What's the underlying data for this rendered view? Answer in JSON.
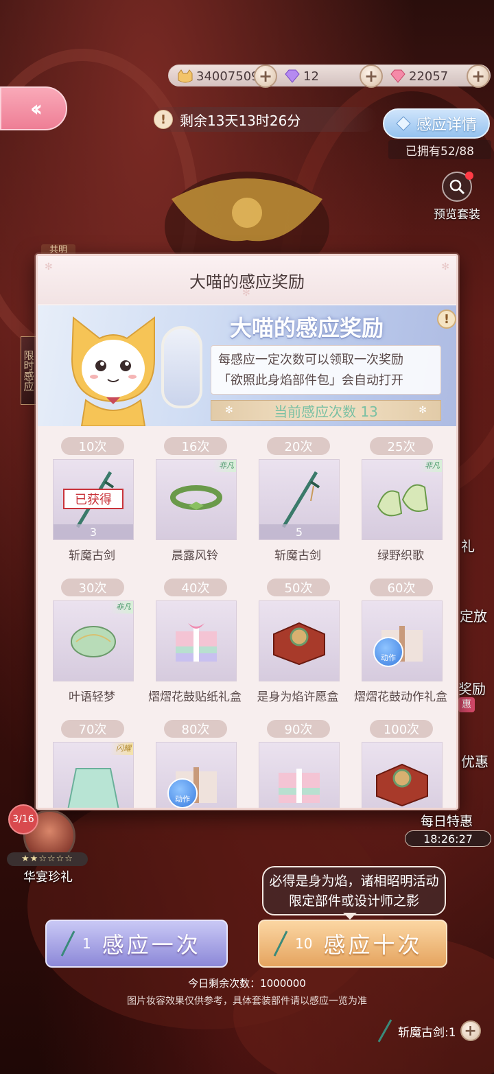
{
  "topbar": {
    "gold": "34007509",
    "diamond_purple": "12",
    "diamond_pink": "22057"
  },
  "timer": {
    "text": "剩余13天13时26分"
  },
  "detail": {
    "label": "感应详情",
    "owned": "已拥有52/88"
  },
  "preview": {
    "label": "预览套装"
  },
  "side": {
    "left_tag": "限时感应",
    "left_badge": "共明",
    "right_1": "礼",
    "right_2": "定放",
    "right_3": "奖励",
    "right_4": "惠",
    "right_5": "优惠"
  },
  "modal": {
    "title": "大喵的感应奖励",
    "banner_title": "大喵的感应奖励",
    "desc_line1": "每感应一定次数可以领取一次奖励",
    "desc_line2": "「欲照此身焰部件包」会自动打开",
    "current_count": "当前感应次数 13",
    "acquired_label": "已获得",
    "rarity_label": "非凡",
    "rarity_label_gold": "闪耀",
    "motion_label": "动作",
    "items": [
      {
        "count": "10次",
        "name": "斩魔古剑",
        "qty": "3",
        "acquired": true
      },
      {
        "count": "16次",
        "name": "晨露风铃",
        "qty": "",
        "rarity": "non"
      },
      {
        "count": "20次",
        "name": "斩魔古剑",
        "qty": "5"
      },
      {
        "count": "25次",
        "name": "绿野织歌",
        "qty": "",
        "rarity": "non"
      },
      {
        "count": "30次",
        "name": "叶语轻梦",
        "qty": "",
        "rarity": "non"
      },
      {
        "count": "40次",
        "name": "熠熠花鼓贴纸礼盒",
        "qty": ""
      },
      {
        "count": "50次",
        "name": "是身为焰许愿盒",
        "qty": ""
      },
      {
        "count": "60次",
        "name": "熠熠花鼓动作礼盒",
        "qty": "",
        "motion": true
      },
      {
        "count": "70次",
        "name": "",
        "qty": "",
        "rarity": "gold"
      },
      {
        "count": "80次",
        "name": "",
        "qty": "",
        "motion": true
      },
      {
        "count": "90次",
        "name": "",
        "qty": ""
      },
      {
        "count": "100次",
        "name": "",
        "qty": ""
      }
    ]
  },
  "profile": {
    "progress": "3/16",
    "stars": "★★☆☆☆☆",
    "label": "华宴珍礼"
  },
  "daily": {
    "label": "每日特惠",
    "timer": "18:26:27"
  },
  "tip": {
    "text": "必得是身为焰，诸相昭明活动限定部件或设计师之影"
  },
  "actions": {
    "one_count": "1",
    "one_label": "感应一次",
    "ten_count": "10",
    "ten_label": "感应十次"
  },
  "footer": {
    "remaining": "今日剩余次数：1000000",
    "disclaimer": "图片妆容效果仅供参考，具体套装部件请以感应一览为准",
    "sword_count": "斩魔古剑:1"
  },
  "colors": {
    "accent_pink": "#ee7e95",
    "accent_blue": "#95c2ef",
    "accent_gold": "#e5a45f",
    "stamp_red": "#c9333a"
  }
}
